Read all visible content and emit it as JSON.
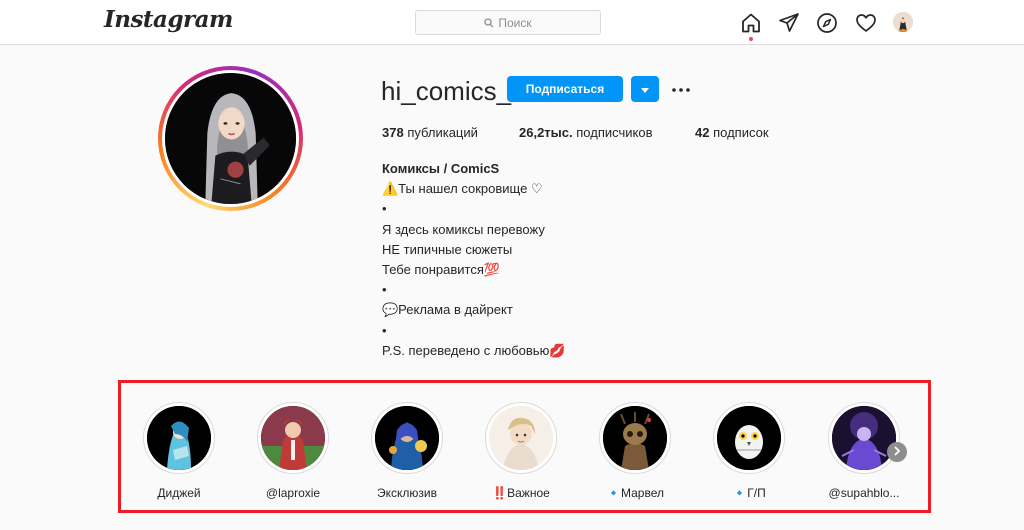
{
  "topbar": {
    "logo_text": "Instagram",
    "search_placeholder": "Поиск",
    "icons": [
      "home-icon",
      "direct-icon",
      "explore-icon",
      "heart-icon",
      "avatar"
    ]
  },
  "profile": {
    "username": "hi_comics_",
    "follow_label": "Подписаться",
    "stats": {
      "posts_count": "378",
      "posts_label": "публикаций",
      "followers_count": "26,2тыс.",
      "followers_label": "подписчиков",
      "following_count": "42",
      "following_label": "подписок"
    },
    "bio": {
      "name": "Комиксы / ComicS",
      "lines": [
        "⚠️Ты нашел сокровище ♡",
        "•",
        "Я здесь комиксы перевожу",
        "НЕ типичные сюжеты",
        "Тебе понравится💯",
        "•",
        "💬Реклама в дайрект",
        "•",
        "P.S. переведено с любовью💋"
      ]
    }
  },
  "highlights": [
    {
      "label": "Диджей"
    },
    {
      "label": "@laproxie"
    },
    {
      "label": "Эксклюзив"
    },
    {
      "label": "‼️Важное"
    },
    {
      "label": "🔹Марвел"
    },
    {
      "label": "🔹Г/П"
    },
    {
      "label": "@supahblo..."
    }
  ],
  "colors": {
    "accent": "#0095f6",
    "highlight_frame": "#ef1c24",
    "notification_dot": "#ed4956"
  }
}
